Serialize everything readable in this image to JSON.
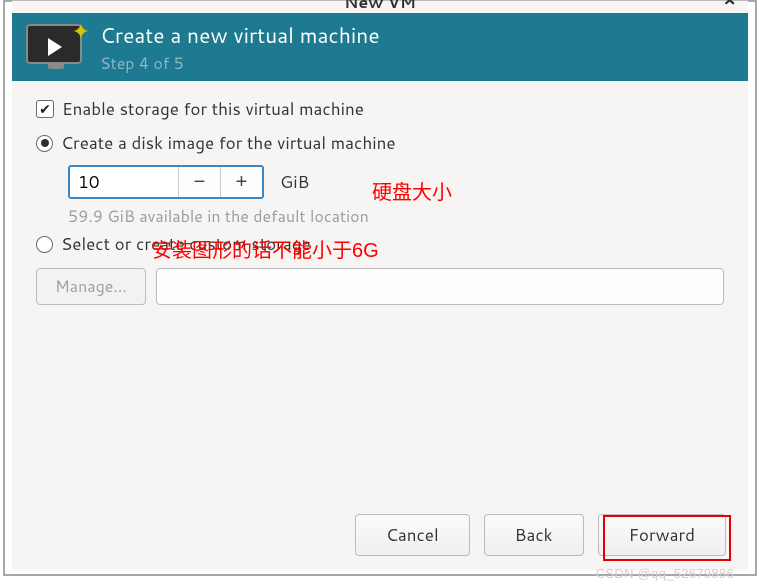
{
  "titlebar": {
    "title": "New VM",
    "close_glyph": "×"
  },
  "header": {
    "title": "Create a new virtual machine",
    "step": "Step 4 of 5"
  },
  "storage": {
    "enable_label": "Enable storage for this virtual machine",
    "enable_checked": true,
    "create_disk_label": "Create a disk image for the virtual machine",
    "create_disk_selected": true,
    "size_value": "10",
    "size_unit": "GiB",
    "available_hint": "59.9 GiB available in the default location",
    "custom_label": "Select or create custom storage",
    "custom_selected": false,
    "manage_label": "Manage...",
    "path_value": ""
  },
  "footer": {
    "cancel": "Cancel",
    "back": "Back",
    "forward": "Forward"
  },
  "annotations": {
    "disk_size": "硬盘大小",
    "min_size": "安装图形的话不能小于6G"
  },
  "watermark": "CSDN @qq_52679886"
}
